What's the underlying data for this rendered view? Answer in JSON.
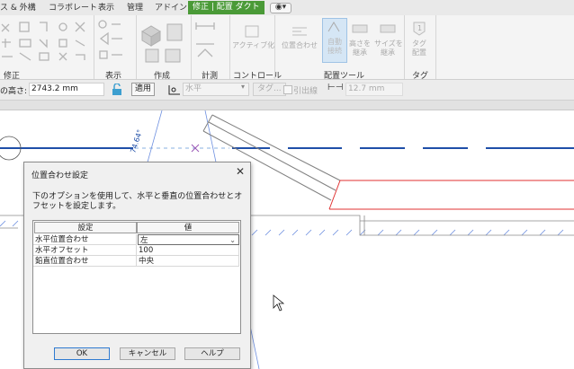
{
  "tabs": [
    {
      "label": "ス & 外構"
    },
    {
      "label": "コラボレート"
    },
    {
      "label": "表示"
    },
    {
      "label": "管理"
    },
    {
      "label": "アドイン"
    },
    {
      "label": "修正 | 配置 ダクト"
    }
  ],
  "ribbon": {
    "groups": {
      "modify": "修正",
      "view": "表示",
      "create": "作成",
      "measure": "計測",
      "control": "コントロール",
      "placement_tools": "配置ツール",
      "tag": "タグ"
    },
    "buttons": {
      "activate": "アクティブ化",
      "justify": "位置合わせ",
      "auto_connect_1": "自動",
      "auto_connect_2": "接続",
      "inherit_elev_1": "高さを",
      "inherit_elev_2": "継承",
      "inherit_size_1": "サイズを",
      "inherit_size_2": "継承",
      "tag_on_place_1": "タグ",
      "tag_on_place_2": "配置"
    }
  },
  "options_bar": {
    "height_label": "の高さ:",
    "height_value": "2743.2 mm",
    "apply_button": "適用",
    "orientation": "水平",
    "tag_button": "タグ...",
    "leader_label": "引出線",
    "leader_length": "12.7 mm"
  },
  "canvas": {
    "angle_label": "74.64°"
  },
  "dialog": {
    "title": "位置合わせ設定",
    "description": "下のオプションを使用して、水平と垂直の位置合わせとオフセットを設定します。",
    "col_setting": "設定",
    "col_value": "値",
    "rows": [
      {
        "setting": "水平位置合わせ",
        "value": "左"
      },
      {
        "setting": "水平オフセット",
        "value": "100"
      },
      {
        "setting": "鉛直位置合わせ",
        "value": "中央"
      }
    ],
    "ok": "OK",
    "cancel": "キャンセル",
    "help": "ヘルプ"
  },
  "colors": {
    "accent_tab": "#4a9a37",
    "grid_line": "#1f4fa8",
    "duct_selected": "#e03030",
    "hatch": "#6d8fe0"
  }
}
